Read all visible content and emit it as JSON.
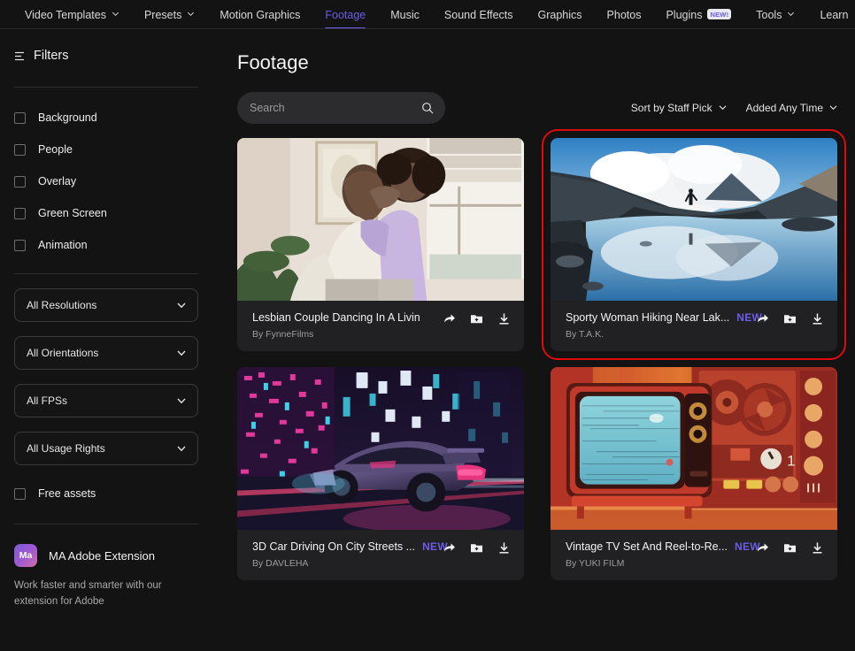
{
  "nav": {
    "items": [
      {
        "label": "Video Templates",
        "caret": true,
        "active": false,
        "badge": ""
      },
      {
        "label": "Presets",
        "caret": true,
        "active": false,
        "badge": ""
      },
      {
        "label": "Motion Graphics",
        "caret": false,
        "active": false,
        "badge": ""
      },
      {
        "label": "Footage",
        "caret": false,
        "active": true,
        "badge": ""
      },
      {
        "label": "Music",
        "caret": false,
        "active": false,
        "badge": ""
      },
      {
        "label": "Sound Effects",
        "caret": false,
        "active": false,
        "badge": ""
      },
      {
        "label": "Graphics",
        "caret": false,
        "active": false,
        "badge": ""
      },
      {
        "label": "Photos",
        "caret": false,
        "active": false,
        "badge": ""
      },
      {
        "label": "Plugins",
        "caret": false,
        "active": false,
        "badge": "NEW!"
      },
      {
        "label": "Tools",
        "caret": true,
        "active": false,
        "badge": ""
      },
      {
        "label": "Learn",
        "caret": false,
        "active": false,
        "badge": ""
      }
    ]
  },
  "sidebar": {
    "filters_label": "Filters",
    "checkboxes": [
      {
        "label": "Background",
        "checked": false
      },
      {
        "label": "People",
        "checked": false
      },
      {
        "label": "Overlay",
        "checked": false
      },
      {
        "label": "Green Screen",
        "checked": false
      },
      {
        "label": "Animation",
        "checked": false
      }
    ],
    "selects": [
      {
        "value": "All Resolutions"
      },
      {
        "value": "All Orientations"
      },
      {
        "value": "All FPSs"
      },
      {
        "value": "All Usage Rights"
      }
    ],
    "free_assets": {
      "label": "Free assets",
      "checked": false
    },
    "extension": {
      "logo_text": "Ma",
      "title": "MA Adobe Extension",
      "description": "Work faster and smarter with our extension for Adobe"
    }
  },
  "main": {
    "page_title": "Footage",
    "search": {
      "value": "",
      "placeholder": "Search"
    },
    "sort_by": "Sort by Staff Pick",
    "added": "Added Any Time",
    "cards": [
      {
        "title": "Lesbian Couple Dancing In A Living Ro...",
        "author": "By FynneFilms",
        "badge": "",
        "art": "living-room",
        "highlighted": false
      },
      {
        "title": "Sporty Woman Hiking Near Lak...",
        "author": "By T.A.K.",
        "badge": "NEW",
        "art": "mountain-lake",
        "highlighted": true
      },
      {
        "title": "3D Car Driving On City Streets ...",
        "author": "By DAVLEHA",
        "badge": "NEW",
        "art": "neon-car",
        "highlighted": false
      },
      {
        "title": "Vintage TV Set And Reel-to-Re...",
        "author": "By YUKI FILM",
        "badge": "NEW",
        "art": "vintage-tv",
        "highlighted": false
      }
    ],
    "card_actions": [
      "share-icon",
      "add-to-folder-icon",
      "download-icon"
    ]
  },
  "colors": {
    "accent": "#6c5ce7",
    "highlight_border": "#e00b0b",
    "background": "#131313",
    "card_background": "#212123"
  }
}
